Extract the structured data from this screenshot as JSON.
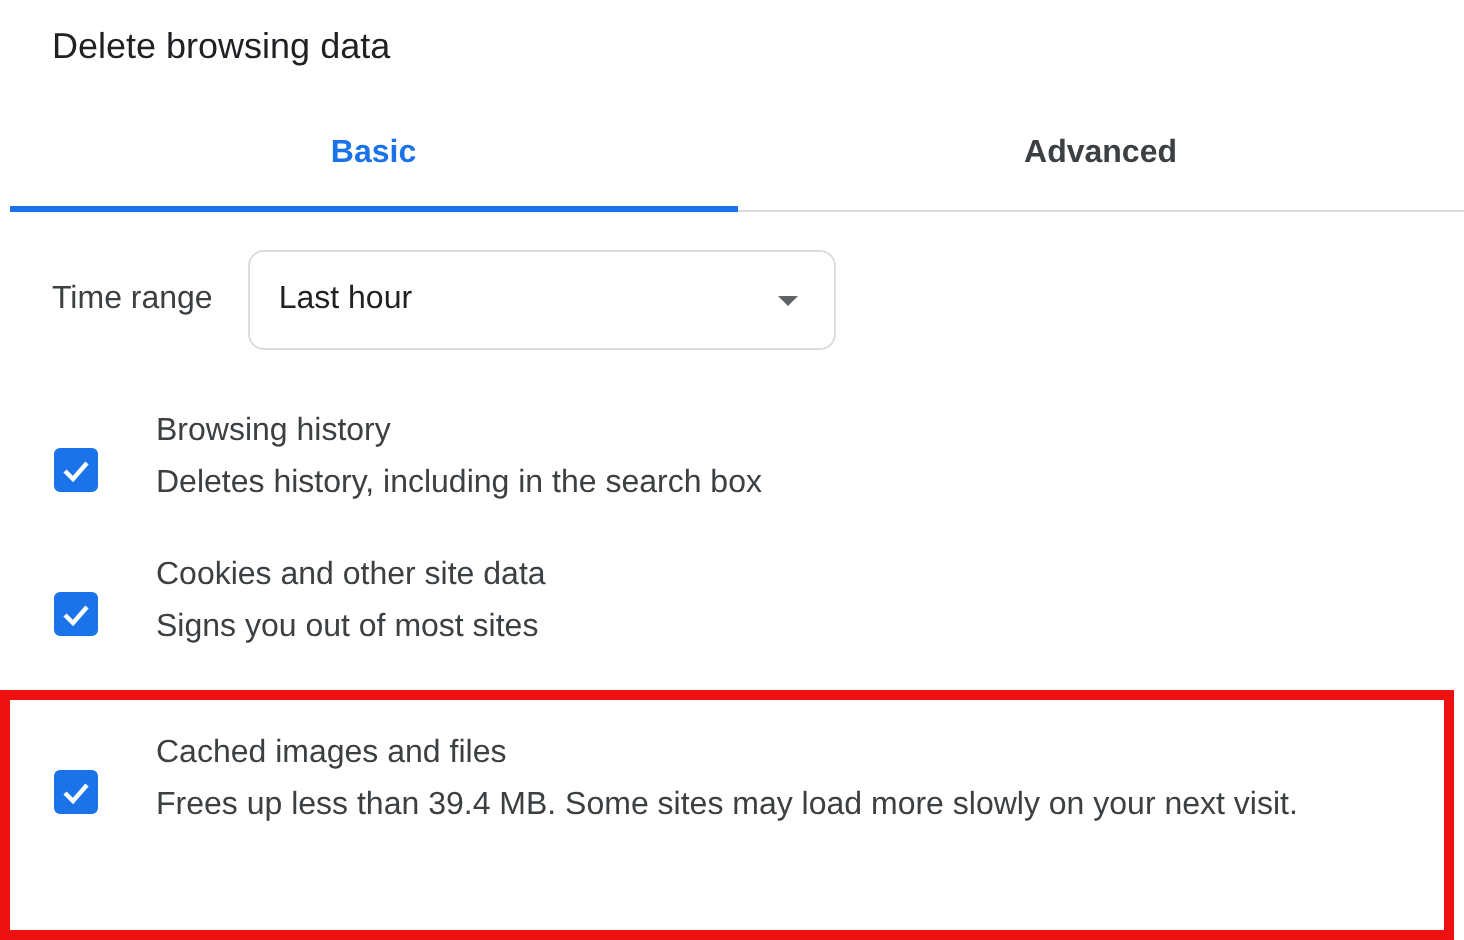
{
  "dialog": {
    "title": "Delete browsing data"
  },
  "tabs": [
    {
      "label": "Basic",
      "selected": true
    },
    {
      "label": "Advanced",
      "selected": false
    }
  ],
  "time_range": {
    "label": "Time range",
    "value": "Last hour"
  },
  "options": [
    {
      "title": "Browsing history",
      "description": "Deletes history, including in the search box",
      "checked": true,
      "highlighted": false
    },
    {
      "title": "Cookies and other site data",
      "description": "Signs you out of most sites",
      "checked": true,
      "highlighted": false
    },
    {
      "title": "Cached images and files",
      "description": "Frees up less than 39.4 MB. Some sites may load more slowly on your next visit.",
      "checked": true,
      "highlighted": true
    }
  ]
}
